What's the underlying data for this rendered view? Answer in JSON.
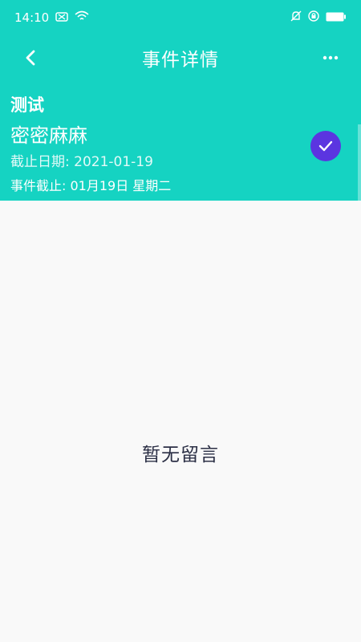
{
  "status_bar": {
    "time": "14:10"
  },
  "app_bar": {
    "title": "事件详情"
  },
  "event": {
    "category": "测试",
    "title": "密密麻麻",
    "deadline": "截止日期: 2021-01-19",
    "countdown": "事件截止: 01月19日 星期二"
  },
  "content": {
    "empty_message": "暂无留言"
  },
  "colors": {
    "primary": "#15d3c2",
    "accent": "#5b35e0",
    "background": "#f9f9f9",
    "empty_text": "#2b2f45"
  },
  "icons": {
    "back": "back-arrow-icon",
    "more": "more-dots-icon",
    "check": "check-icon",
    "notification": "notification-icon",
    "wifi": "wifi-icon",
    "mute": "mute-icon",
    "lock": "lock-icon",
    "battery": "battery-icon"
  }
}
